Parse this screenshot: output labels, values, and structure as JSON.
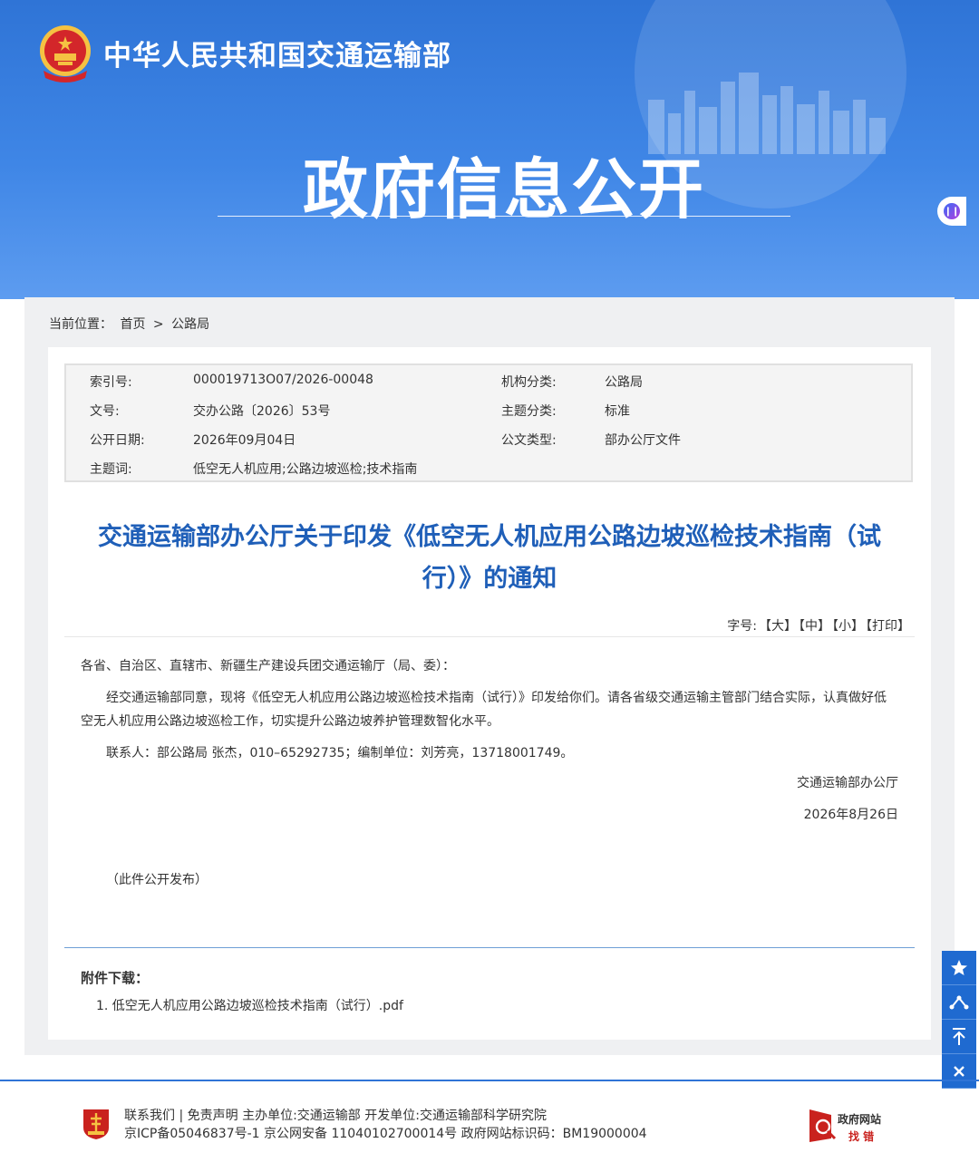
{
  "header": {
    "ministry": "中华人民共和国交通运输部",
    "section_title": "政府信息公开"
  },
  "breadcrumb": {
    "label": "当前位置：",
    "home": "首页",
    "separator": ">",
    "current": "公路局"
  },
  "meta": [
    {
      "label": "索引号:",
      "value": "000019713O07/2026-00048",
      "label2": "机构分类:",
      "value2": "公路局"
    },
    {
      "label": "文号:",
      "value": "交办公路〔2026〕53号",
      "label2": "主题分类:",
      "value2": "标准"
    },
    {
      "label": "公开日期:",
      "value": "2026年09月04日",
      "label2": "公文类型:",
      "value2": "部办公厅文件"
    },
    {
      "label": "主题词:",
      "value": "低空无人机应用;公路边坡巡检;技术指南",
      "label2": "",
      "value2": ""
    }
  ],
  "article": {
    "title_line1": "交通运输部办公厅关于印发《低空无人机应用公路边坡巡检技术指南（试",
    "title_line2": "行）》的通知",
    "fontsize_label": "字号:",
    "fontsize_large": "【大】",
    "fontsize_medium": "【中】",
    "fontsize_small": "【小】",
    "print": "【打印】",
    "salutation": "各省、自治区、直辖市、新疆生产建设兵团交通运输厅（局、委）：",
    "para1_line1": "经交通运输部同意，现将《低空无人机应用公路边坡巡检技术指南（试行）》印发给你们。请各省级交通运输主管部门结合实际，认真做好低",
    "para1_line2": "空无人机应用公路边坡巡检工作，切实提升公路边坡养护管理数智化水平。",
    "contact": "联系人：部公路局 张杰，010–65292735；编制单位：刘芳亮，13718001749。",
    "signer": "交通运输部办公厅",
    "date": "2026年8月26日",
    "note": "（此件公开发布）"
  },
  "attachments": {
    "title": "附件下载：",
    "items": [
      "1. 低空无人机应用公路边坡巡检技术指南（试行）.pdf"
    ]
  },
  "tools": {
    "favorite_icon": "star-icon",
    "share_icon": "share-icon",
    "top_icon": "back-to-top-icon",
    "close_icon": "close-icon"
  },
  "footer": {
    "line1": "联系我们 | 免责声明 主办单位:交通运输部 开发单位:交通运输部科学研究院",
    "line2": "京ICP备05046837号-1  京公网安备  11040102700014号  政府网站标识码：BM19000004",
    "badge_top": "政府网站",
    "badge_bottom": "找 错"
  },
  "colors": {
    "header_blue": "#2f74d6",
    "title_blue": "#1f5fb8",
    "tool_blue": "#1f6ad0"
  }
}
